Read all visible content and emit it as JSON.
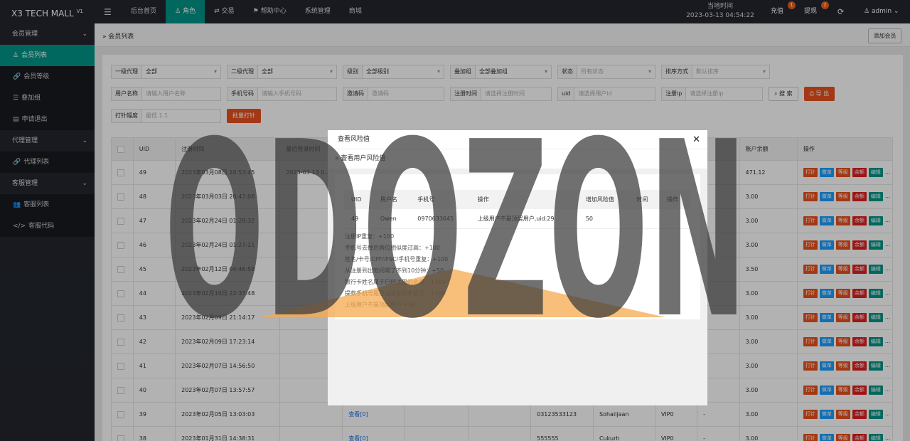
{
  "header": {
    "logo": "X3 TECH MALL",
    "logo_version": "V1",
    "nav": [
      {
        "label": "后台首页",
        "icon": ""
      },
      {
        "label": "角色",
        "icon": "user-icon",
        "active": true
      },
      {
        "label": "交易",
        "icon": "exchange-icon"
      },
      {
        "label": "帮助中心",
        "icon": "flag-icon"
      },
      {
        "label": "系统管理",
        "icon": ""
      },
      {
        "label": "商城",
        "icon": ""
      }
    ],
    "time_label": "当地时间",
    "time_value": "2023-03-13 04:54:22",
    "recharge": "充值",
    "recharge_badge": "1",
    "withdraw": "提现",
    "withdraw_badge": "2",
    "refresh_icon": "refresh-icon",
    "user": "admin"
  },
  "sidebar": [
    {
      "label": "会员管理",
      "group": true
    },
    {
      "label": "会员列表",
      "icon": "user-icon",
      "active": true
    },
    {
      "label": "会员等级",
      "icon": "link-icon"
    },
    {
      "label": "叠加组",
      "icon": "list-icon"
    },
    {
      "label": "申请退出",
      "icon": "doc-icon"
    },
    {
      "label": "代理管理",
      "group": true
    },
    {
      "label": "代理列表",
      "icon": "link-icon"
    },
    {
      "label": "客服管理",
      "group": true
    },
    {
      "label": "客服列表",
      "icon": "users-icon"
    },
    {
      "label": "客服代码",
      "icon": "code-icon"
    }
  ],
  "breadcrumb": "会员列表",
  "add_member": "添加会员",
  "filters": {
    "row1": [
      {
        "label": "一级代理",
        "value": "全部",
        "select": true
      },
      {
        "label": "二级代理",
        "value": "全部",
        "select": true
      },
      {
        "label": "级别",
        "value": "全部级别",
        "select": true
      },
      {
        "label": "叠加组",
        "value": "全部叠加组",
        "select": true
      },
      {
        "label": "状态",
        "value": "所有状态",
        "select": true,
        "placeholder": true
      },
      {
        "label": "排序方式",
        "value": "默认排序",
        "select": true,
        "placeholder": true
      }
    ],
    "row2": [
      {
        "label": "用户名称",
        "value": "请输入用户名称",
        "placeholder": true
      },
      {
        "label": "手机号码",
        "value": "请输入手机号码",
        "placeholder": true
      },
      {
        "label": "邀请码",
        "value": "邀请码",
        "placeholder": true
      },
      {
        "label": "注册时间",
        "value": "请选择注册时间",
        "placeholder": true
      },
      {
        "label": "uid",
        "value": "请选择用户id",
        "placeholder": true
      },
      {
        "label": "注册ip",
        "value": "请选择注册ip",
        "placeholder": true
      }
    ],
    "search": "搜 索",
    "export": "导 出",
    "row3": {
      "label": "打针幅度",
      "value": "最低 1.1",
      "batch": "批量打针"
    }
  },
  "table": {
    "headers": [
      "",
      "UID",
      "注册时间",
      "最后登录时间",
      "",
      "",
      "",
      "",
      "",
      "",
      "",
      "账户余额",
      "操作"
    ],
    "ops": [
      "打针",
      "做单",
      "等级",
      "余额",
      "编辑"
    ],
    "more": "...",
    "rows": [
      {
        "uid": "49",
        "reg": "2023年03月08日 10:53:45",
        "last": "2023-03-13 0...",
        "c3": "",
        "c4": "",
        "c5": "",
        "phone": "",
        "name": "",
        "vip": "",
        "dash": "",
        "bal": "471.12"
      },
      {
        "uid": "48",
        "reg": "2023年03月03日 20:47:08",
        "last": "",
        "c3": "",
        "c4": "",
        "c5": "",
        "phone": "",
        "name": "",
        "vip": "",
        "dash": "",
        "bal": "3.00"
      },
      {
        "uid": "47",
        "reg": "2023年02月24日 01:28:32",
        "last": "",
        "c3": "",
        "c4": "",
        "c5": "",
        "phone": "",
        "name": "",
        "vip": "",
        "dash": "",
        "bal": "3.00"
      },
      {
        "uid": "46",
        "reg": "2023年02月24日 01:27:11",
        "last": "",
        "c3": "",
        "c4": "",
        "c5": "",
        "phone": "",
        "name": "",
        "vip": "",
        "dash": "",
        "bal": "3.00"
      },
      {
        "uid": "45",
        "reg": "2023年02月12日 04:46:58",
        "last": "",
        "c3": "",
        "c4": "",
        "c5": "",
        "phone": "",
        "name": "",
        "vip": "",
        "dash": "",
        "bal": "3.50"
      },
      {
        "uid": "44",
        "reg": "2023年02月10日 22:37:48",
        "last": "",
        "c3": "",
        "c4": "",
        "c5": "",
        "phone": "",
        "name": "",
        "vip": "",
        "dash": "",
        "bal": "3.00"
      },
      {
        "uid": "43",
        "reg": "2023年02月09日 21:14:17",
        "last": "",
        "c3": "",
        "c4": "",
        "c5": "",
        "phone": "",
        "name": "",
        "vip": "",
        "dash": "",
        "bal": "3.00"
      },
      {
        "uid": "42",
        "reg": "2023年02月09日 17:23:14",
        "last": "",
        "c3": "",
        "c4": "",
        "c5": "",
        "phone": "",
        "name": "",
        "vip": "",
        "dash": "",
        "bal": "3.00"
      },
      {
        "uid": "41",
        "reg": "2023年02月07日 14:56:50",
        "last": "",
        "c3": "",
        "c4": "",
        "c5": "",
        "phone": "",
        "name": "",
        "vip": "",
        "dash": "",
        "bal": "3.00"
      },
      {
        "uid": "40",
        "reg": "2023年02月07日 13:57:57",
        "last": "",
        "c3": "",
        "c4": "",
        "c5": "",
        "phone": "",
        "name": "",
        "vip": "",
        "dash": "",
        "bal": "3.00"
      },
      {
        "uid": "39",
        "reg": "2023年02月05日 13:03:03",
        "last": "",
        "c3": "查看[0]",
        "c4": "",
        "c5": "",
        "phone": "03123533123",
        "name": "Sohailjaan",
        "vip": "VIP0",
        "dash": "-",
        "bal": "3.00"
      },
      {
        "uid": "38",
        "reg": "2023年01月31日 14:38:31",
        "last": "",
        "c3": "查看[0]",
        "c4": "",
        "c5": "",
        "phone": "555555",
        "name": "Cukurh",
        "vip": "VIP0",
        "dash": "-",
        "bal": "3.00"
      }
    ]
  },
  "modal": {
    "title": "查看风险值",
    "subtitle": "查看用户风险值",
    "headers": [
      "UID",
      "用户名",
      "手机号",
      "操作",
      "增加风险值",
      "时间",
      "操作"
    ],
    "row": [
      "49",
      "Owen",
      "0970633645",
      "上级用户不是顶层用户,uid:29",
      "50",
      "",
      ""
    ],
    "rules": [
      "注册IP重复：+100",
      "手机号去掉后两位相似度过高：+100",
      "姓名/卡号/CPF/IFSC/手机号重复：+100",
      "从注册到出款间隔了不到10分钟：+50",
      "银行卡姓名属于已经注册的会员：+100",
      "提款手机号是已注册会员手机号：+100",
      "上级用户不是顶层用户 +50"
    ]
  },
  "watermark": "ODOZON",
  "colors": {
    "brand": "#009688",
    "topbar": "#23262e",
    "danger": "#e9521d",
    "info": "#1e9fff"
  }
}
